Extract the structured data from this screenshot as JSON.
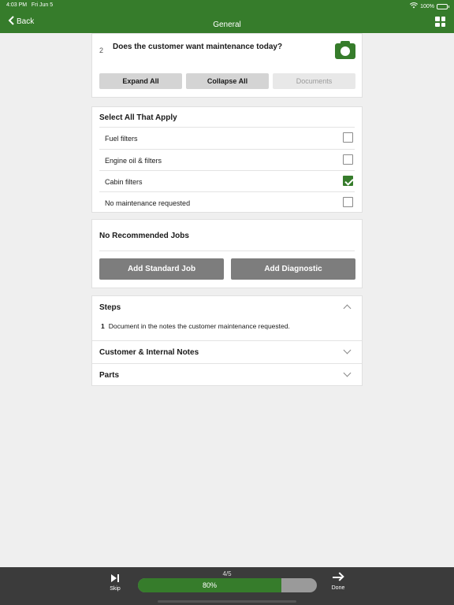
{
  "status": {
    "time": "4:03 PM",
    "date": "Fri Jun 5",
    "battery": "100%"
  },
  "nav": {
    "back_label": "Back",
    "title": "General"
  },
  "question": {
    "number": "2",
    "text": "Does the customer want maintenance today?",
    "expand_label": "Expand All",
    "collapse_label": "Collapse All",
    "documents_label": "Documents"
  },
  "select": {
    "title": "Select All That Apply",
    "options": [
      {
        "label": "Fuel filters",
        "checked": false
      },
      {
        "label": "Engine oil & filters",
        "checked": false
      },
      {
        "label": "Cabin filters",
        "checked": true
      },
      {
        "label": "No maintenance requested",
        "checked": false
      }
    ]
  },
  "jobs": {
    "title": "No Recommended Jobs",
    "add_standard_label": "Add Standard Job",
    "add_diagnostic_label": "Add Diagnostic"
  },
  "sections": {
    "steps_label": "Steps",
    "steps": [
      {
        "num": "1",
        "text": "Document in the notes the customer maintenance requested."
      }
    ],
    "notes_label": "Customer & Internal Notes",
    "parts_label": "Parts"
  },
  "footer": {
    "skip_label": "Skip",
    "done_label": "Done",
    "count": "4/5",
    "progress_label": "80%",
    "progress_fraction": 0.8
  },
  "colors": {
    "accent": "#367c2b",
    "button_gray": "#7d7d7d",
    "footer": "#3b3b3b"
  }
}
